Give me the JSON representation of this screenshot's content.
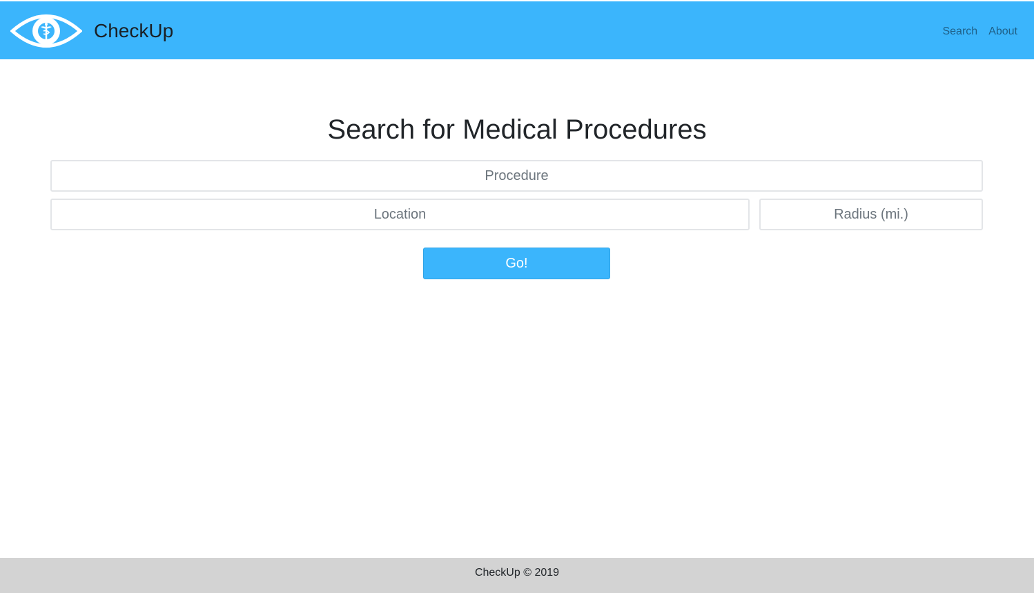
{
  "navbar": {
    "brand": "CheckUp",
    "logo_icon": "eye-caduceus-icon",
    "links": [
      "Search",
      "About"
    ],
    "background_color": "#3bb5fc"
  },
  "search": {
    "title": "Search for Medical Procedures",
    "procedure_placeholder": "Procedure",
    "location_placeholder": "Location",
    "radius_placeholder": "Radius (mi.)",
    "submit_label": "Go!"
  },
  "footer": {
    "text": "CheckUp © 2019",
    "background_color": "#d3d3d3"
  }
}
